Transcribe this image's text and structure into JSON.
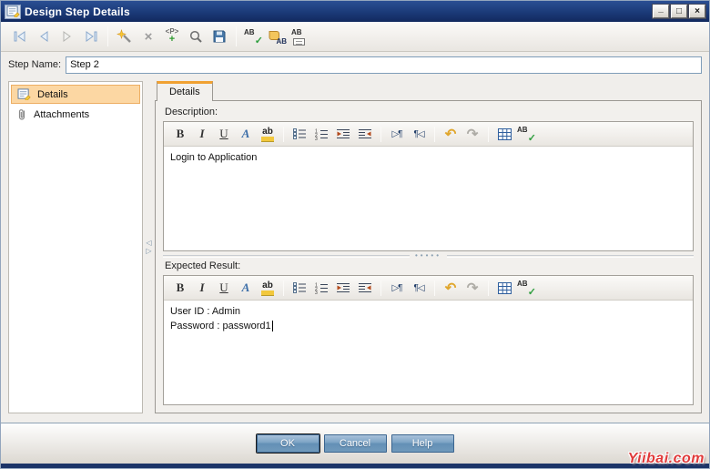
{
  "window": {
    "title": "Design Step Details",
    "controls": {
      "minimize": "_",
      "maximize": "□",
      "close": "×"
    }
  },
  "step_name": {
    "label": "Step Name:",
    "value": "Step 2"
  },
  "sidebar": {
    "items": [
      {
        "label": "Details",
        "selected": true
      },
      {
        "label": "Attachments",
        "selected": false
      }
    ]
  },
  "tab": {
    "label": "Details"
  },
  "description": {
    "label": "Description:",
    "content": "Login to Application"
  },
  "expected_result": {
    "label": "Expected Result:",
    "line1": "User ID : Admin",
    "line2": "Password : password1"
  },
  "actions": {
    "ok": "OK",
    "cancel": "Cancel",
    "help": "Help"
  },
  "icons": {
    "delete_x": "×",
    "param_p": "<P>",
    "plus": "+",
    "ab": "AB",
    "ab_lower": "ab",
    "check": "✓",
    "bold": "B",
    "italic": "I",
    "underline": "U",
    "font_color": "A",
    "ltr": "▷¶",
    "rtl": "¶◁",
    "undo": "↶",
    "redo": "↷",
    "tri_left": "◁",
    "tri_right": "▷",
    "dots": "•••••",
    "num_list": [
      "1",
      "2",
      "3"
    ]
  },
  "colors": {
    "titlebar_blue": "#1b3a78",
    "tab_accent_orange": "#f0a132",
    "selected_item_bg": "#fcd7a3",
    "button_blue": "#6390b6",
    "watermark_red": "#e03a3a"
  },
  "watermark": "Yiibai.com"
}
